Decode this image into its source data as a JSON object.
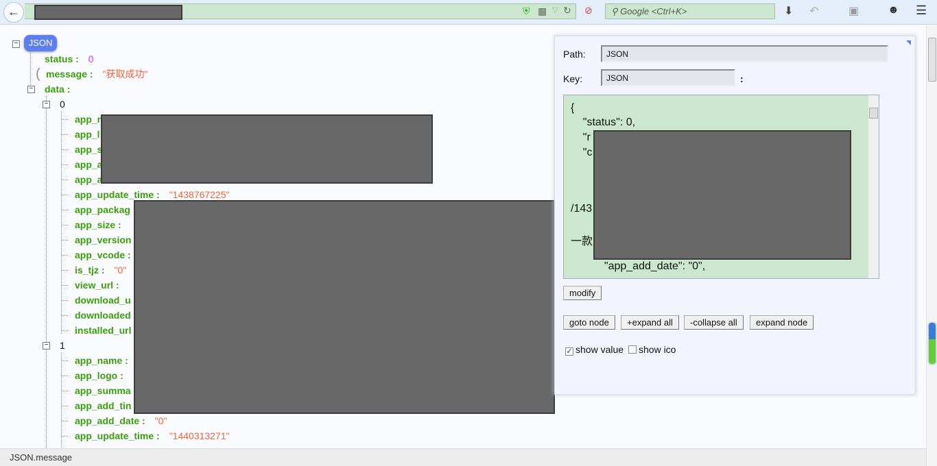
{
  "browser": {
    "search_placeholder": "Google <Ctrl+K>"
  },
  "tree": {
    "root": "JSON",
    "status": {
      "key": "status :",
      "value": "0"
    },
    "message": {
      "key": "message :",
      "value": "\"获取成功\""
    },
    "data": {
      "key": "data :"
    },
    "items": [
      {
        "index": "0",
        "rows": [
          {
            "key": "app_n"
          },
          {
            "key": "app_l"
          },
          {
            "key": "app_s"
          },
          {
            "key": "app_a"
          },
          {
            "key": "app_a"
          },
          {
            "key": "app_update_time :",
            "value": "\"1438767225\""
          },
          {
            "key": "app_packag"
          },
          {
            "key": "app_size :"
          },
          {
            "key": "app_version"
          },
          {
            "key": "app_vcode :"
          },
          {
            "key": "is_tjz :",
            "value": "\"0\""
          },
          {
            "key": "view_url :"
          },
          {
            "key": "download_u"
          },
          {
            "key": "downloaded"
          },
          {
            "key": "installed_url"
          }
        ]
      },
      {
        "index": "1",
        "rows": [
          {
            "key": "app_name :"
          },
          {
            "key": "app_logo :"
          },
          {
            "key": "app_summa"
          },
          {
            "key": "app_add_tin"
          },
          {
            "key": "app_add_date :",
            "value": "\"0\""
          },
          {
            "key": "app_update_time :",
            "value": "\"1440313271\""
          }
        ]
      }
    ]
  },
  "panel": {
    "path_label": "Path:",
    "path_value": "JSON",
    "key_label": "Key:",
    "key_value": "JSON",
    "colon": ":",
    "text_lines": [
      "{",
      "    \"status\": 0,",
      "    \"r",
      "    \"c",
      "/143",
      "一款",
      "           \"app_add_date\": \"0\","
    ],
    "modify": "modify",
    "goto": "goto node",
    "expand_all": "+expand all",
    "collapse_all": "-collapse all",
    "expand_node": "expand node",
    "show_value": {
      "label": "show value",
      "checked": true
    },
    "show_ico": {
      "label": "show ico",
      "checked": false
    }
  },
  "statusbar": "JSON.message"
}
